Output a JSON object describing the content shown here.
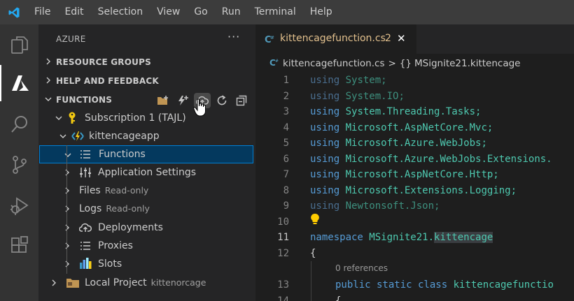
{
  "menubar": {
    "items": [
      "File",
      "Edit",
      "Selection",
      "View",
      "Go",
      "Run",
      "Terminal",
      "Help"
    ]
  },
  "activity_bar": {
    "items": [
      "files-icon",
      "azure-icon",
      "search-icon",
      "source-control-icon",
      "run-debug-icon",
      "extensions-icon"
    ],
    "active": "azure-icon"
  },
  "sidebar": {
    "title": "AZURE",
    "more": "···",
    "sections": {
      "resource_groups": "RESOURCE GROUPS",
      "help_feedback": "HELP AND FEEDBACK",
      "functions": "FUNCTIONS"
    },
    "function_toolbar": [
      "create-project-icon",
      "create-function-icon",
      "deploy-icon",
      "refresh-icon",
      "collapse-all-icon"
    ],
    "tree": {
      "subscription": "Subscription 1 (TAJL)",
      "app": "kittencageapp",
      "functions": "Functions",
      "app_settings": "Application Settings",
      "files": "Files",
      "files_desc": "Read-only",
      "logs": "Logs",
      "logs_desc": "Read-only",
      "deployments": "Deployments",
      "proxies": "Proxies",
      "slots": "Slots",
      "local_project": "Local Project",
      "local_project_desc": "kittenorcage"
    }
  },
  "editor": {
    "tab": {
      "label": "kittencagefunction.cs",
      "problem_count": "2",
      "close": "✕"
    },
    "breadcrumb": {
      "file": "kittencagefunction.cs",
      "separator": ">",
      "symbol_prefix": "{}",
      "symbol": "MSignite21.kittencage"
    },
    "codelens": "0 references",
    "lines": [
      {
        "n": "1",
        "kw": "using",
        "rest": "System;"
      },
      {
        "n": "2",
        "kw": "using",
        "rest": "System.IO;"
      },
      {
        "n": "3",
        "kw": "using",
        "rest": "System.Threading.Tasks;"
      },
      {
        "n": "4",
        "kw": "using",
        "rest": "Microsoft.AspNetCore.Mvc;"
      },
      {
        "n": "5",
        "kw": "using",
        "rest": "Microsoft.Azure.WebJobs;"
      },
      {
        "n": "6",
        "kw": "using",
        "rest": "Microsoft.Azure.WebJobs.Extensions."
      },
      {
        "n": "7",
        "kw": "using",
        "rest": "Microsoft.AspNetCore.Http;"
      },
      {
        "n": "8",
        "kw": "using",
        "rest": "Microsoft.Extensions.Logging;"
      },
      {
        "n": "9",
        "kw": "using",
        "rest": "Newtonsoft.Json;"
      },
      {
        "n": "10"
      },
      {
        "n": "11",
        "kw": "namespace",
        "ns1": "MSignite21.",
        "ns2": "kittencage"
      },
      {
        "n": "12",
        "punc": "{"
      },
      {
        "n": "13",
        "code": "public static class kittencagefunctio"
      },
      {
        "n": "14",
        "punc": "{"
      }
    ]
  },
  "colors": {
    "menubar": "#3c3c3c",
    "activity_bar": "#333333",
    "sidebar": "#252526",
    "editor": "#1e1e1e",
    "selection": "#04395e",
    "focus_border": "#007fd4",
    "modified_file": "#e2c08d",
    "keyword": "#569cd6",
    "type": "#4ec9b0"
  }
}
